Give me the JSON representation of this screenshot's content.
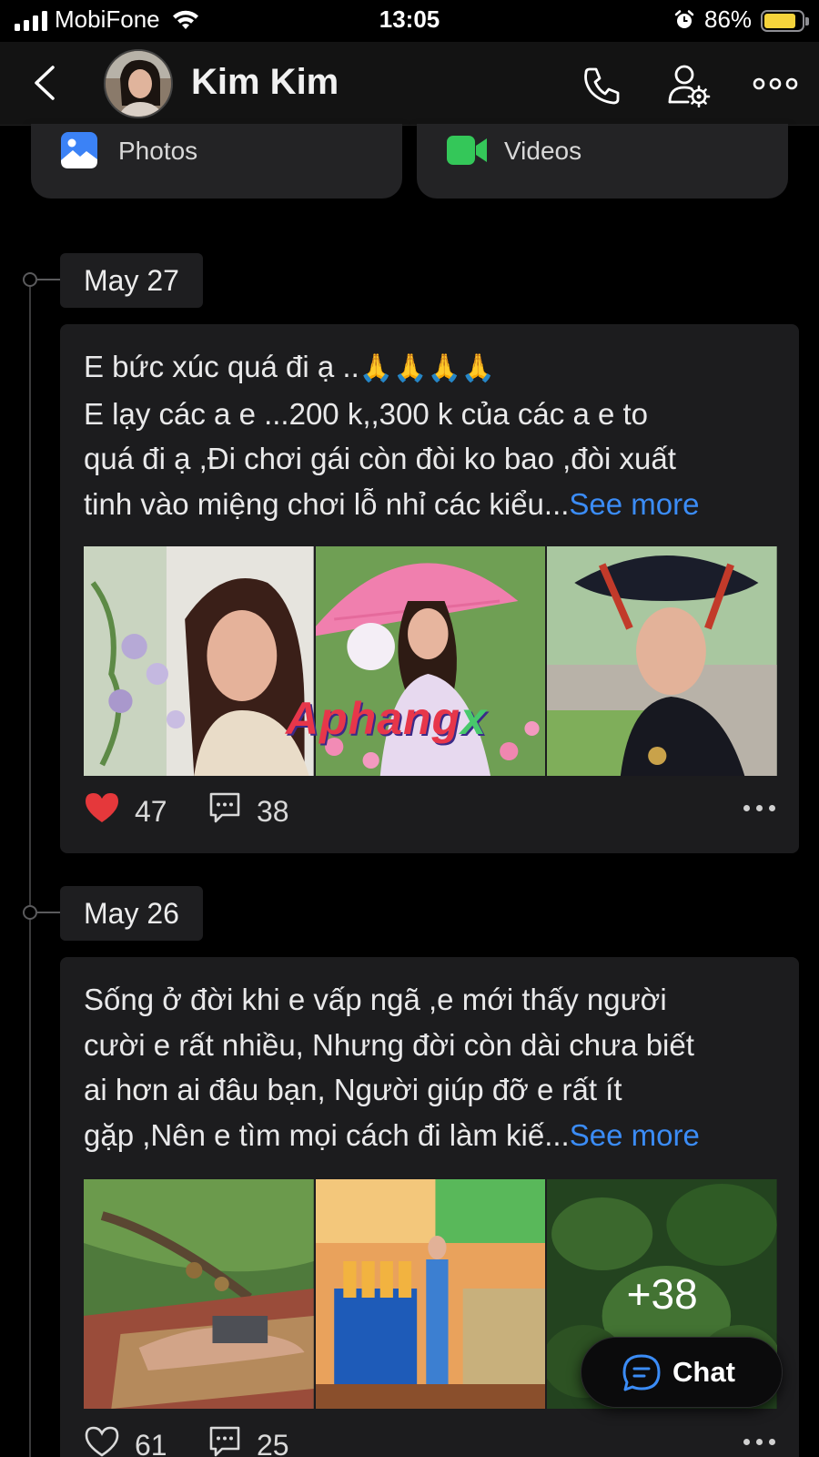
{
  "status_bar": {
    "carrier": "MobiFone",
    "time": "13:05",
    "battery_percent": "86%",
    "battery_level": 0.86,
    "battery_color": "#f5d33b"
  },
  "header": {
    "contact_name": "Kim Kim",
    "icons": [
      "back-chevron-icon",
      "phone-icon",
      "profile-settings-icon",
      "more-icon"
    ]
  },
  "media_tabs": [
    {
      "label": "Photos",
      "icon": "photos-icon",
      "color": "#3b82f6"
    },
    {
      "label": "Videos",
      "icon": "video-camera-icon",
      "color": "#34c759"
    }
  ],
  "posts": [
    {
      "date": "May 27",
      "text_lines": [
        "E bức xúc quá đi ạ ..",
        "E lạy các a e ...200 k,,300 k của các a e to",
        "quá đi ạ ,Đi chơi gái còn đòi ko bao ,đòi xuất",
        "tinh vào miệng chơi lỗ nhỉ các kiểu..."
      ],
      "emoji": "🙏🙏🙏🙏",
      "see_more": "See more",
      "watermark_text": "Aphang",
      "watermark_suffix": "x",
      "likes": "47",
      "comments": "38",
      "liked": true
    },
    {
      "date": "May 26",
      "text_lines": [
        "Sống ở đời khi e vấp ngã ,e mới thấy người",
        "cười e rất nhiều, Nhưng đời còn dài chưa biết",
        "ai hơn ai đâu bạn, Người giúp đỡ e rất ít",
        "gặp ,Nên e tìm mọi cách đi làm kiế..."
      ],
      "see_more": "See more",
      "more_photos": "+38",
      "likes": "61",
      "comments": "25",
      "liked": false
    }
  ],
  "chat_button": {
    "label": "Chat",
    "accent": "#3b8cf6"
  },
  "colors": {
    "link": "#3b8cf6",
    "like_red": "#e5383b",
    "background": "#000000",
    "card": "#1c1c1e"
  }
}
